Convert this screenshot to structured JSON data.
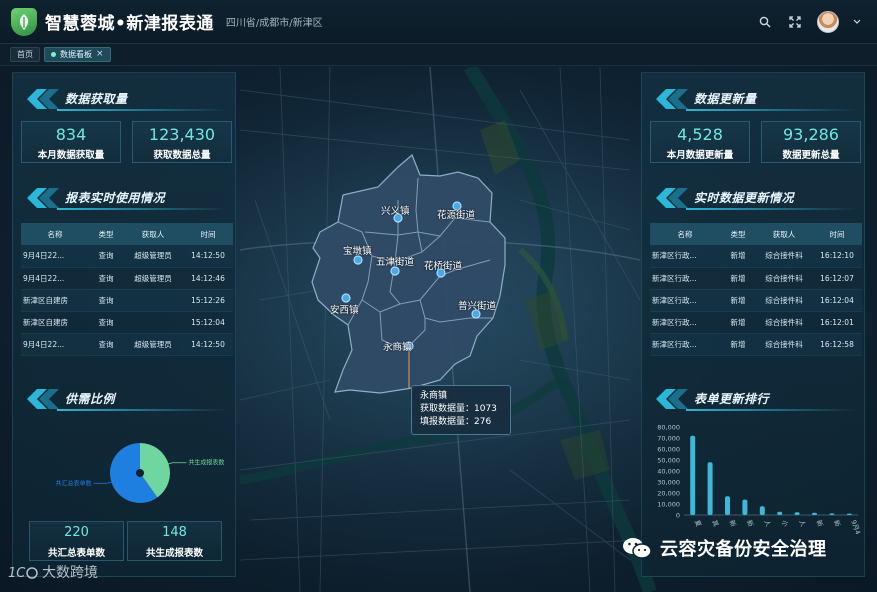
{
  "header": {
    "app_title": "智慧蓉城•新津报表通",
    "location": "四川省/成都市/新津区",
    "icons": [
      "search-icon",
      "fullscreen-icon",
      "user-avatar"
    ]
  },
  "tabs": [
    {
      "label": "首页",
      "active": false
    },
    {
      "label": "数据看板",
      "active": true,
      "close": "×"
    }
  ],
  "left_panel": {
    "acquisition": {
      "title": "数据获取量",
      "stats": [
        {
          "value": "834",
          "label": "本月数据获取量"
        },
        {
          "value": "123,430",
          "label": "获取数据总量"
        }
      ]
    },
    "usage": {
      "title": "报表实时使用情况",
      "columns": [
        "名称",
        "类型",
        "获取人",
        "时间"
      ],
      "rows": [
        [
          "9月4日22...",
          "查询",
          "超级管理员",
          "14:12:50"
        ],
        [
          "9月4日22...",
          "查询",
          "超级管理员",
          "14:12:46"
        ],
        [
          "新津区自建房",
          "查询",
          "",
          "15:12:26"
        ],
        [
          "新津区自建房",
          "查询",
          "",
          "15:12:04"
        ],
        [
          "9月4日22...",
          "查询",
          "超级管理员",
          "14:12:50"
        ]
      ]
    },
    "ratio": {
      "title": "供需比例",
      "legend": [
        "共生成报表数",
        "共汇总表单数"
      ],
      "stats": [
        {
          "value": "220",
          "label": "共汇总表单数"
        },
        {
          "value": "148",
          "label": "共生成报表数"
        }
      ]
    }
  },
  "right_panel": {
    "update": {
      "title": "数据更新量",
      "stats": [
        {
          "value": "4,528",
          "label": "本月数据更新量"
        },
        {
          "value": "93,286",
          "label": "数据更新总量"
        }
      ]
    },
    "realtime": {
      "title": "实时数据更新情况",
      "columns": [
        "名称",
        "类型",
        "获取人",
        "时间"
      ],
      "rows": [
        [
          "新津区行政...",
          "新增",
          "综合接件科",
          "16:12:10"
        ],
        [
          "新津区行政...",
          "新增",
          "综合接件科",
          "16:12:07"
        ],
        [
          "新津区行政...",
          "新增",
          "综合接件科",
          "16:12:04"
        ],
        [
          "新津区行政...",
          "新增",
          "综合接件科",
          "16:12:01"
        ],
        [
          "新津区行政...",
          "新增",
          "综合接件科",
          "16:12:58"
        ]
      ]
    },
    "ranking": {
      "title": "表单更新排行"
    }
  },
  "map": {
    "towns": [
      "兴义镇",
      "花源街道",
      "宝墩镇",
      "五津街道",
      "花桥街道",
      "安西镇",
      "普兴街道",
      "永商镇"
    ],
    "tooltip": {
      "town": "永商镇",
      "line1": "获取数据量：1073",
      "line2": "填报数据量：276"
    }
  },
  "watermarks": {
    "left": "大数跨境",
    "right": "云容灾备份安全治理"
  },
  "chart_data": [
    {
      "type": "pie",
      "title": "",
      "labels": [
        "共生成报表数",
        "共汇总表单数"
      ],
      "values": [
        148,
        220
      ],
      "colors": [
        "#6fd6a0",
        "#1f7fe0"
      ]
    },
    {
      "type": "bar",
      "title": "",
      "categories": [
        "夏",
        "其",
        "新",
        "新",
        "人",
        "小",
        "人",
        "新",
        "新",
        "9月4"
      ],
      "values": [
        72000,
        48000,
        17000,
        14000,
        8000,
        3000,
        2500,
        2000,
        1500,
        1200
      ],
      "ylim": [
        0,
        80000
      ],
      "yticks": [
        "0",
        "10,000",
        "20,000",
        "30,000",
        "40,000",
        "50,000",
        "60,000",
        "70,000",
        "80,000"
      ],
      "color": "#3fb8d8"
    }
  ],
  "colors": {
    "accent": "#6fe7e1",
    "panel": "#133040",
    "header_bar": "#1f4d61",
    "map_region": "#2f4b66"
  }
}
